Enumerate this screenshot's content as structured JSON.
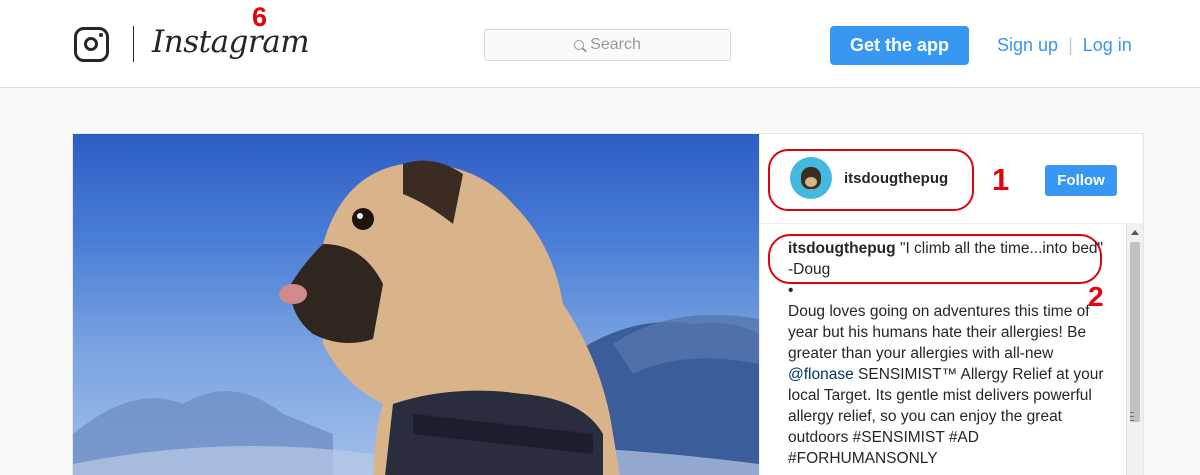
{
  "header": {
    "brand": "Instagram",
    "search_placeholder": "Search",
    "get_app_label": "Get the app",
    "sign_up_label": "Sign up",
    "separator": "|",
    "log_in_label": "Log in"
  },
  "post": {
    "username": "itsdougthepug",
    "follow_label": "Follow",
    "caption_user": "itsdougthepug",
    "caption_quote": "\"I climb all the time...into bed\" -Doug",
    "bullet": "•",
    "body_before_mention": "Doug loves going on adventures this time of year but his humans hate their allergies! Be greater than your allergies with all-new ",
    "mention": "@flonase",
    "body_after_mention": " SENSIMIST™ Allergy Relief at your local Target. Its gentle mist delivers powerful allergy relief, so you can enjoy the great outdoors #SENSIMIST #AD #FORHUMANSONLY"
  },
  "annotations": {
    "label_6": "6",
    "label_1": "1",
    "label_2": "2"
  },
  "colors": {
    "accent": "#3897f0",
    "annotation": "#e00010",
    "text": "#262626"
  }
}
